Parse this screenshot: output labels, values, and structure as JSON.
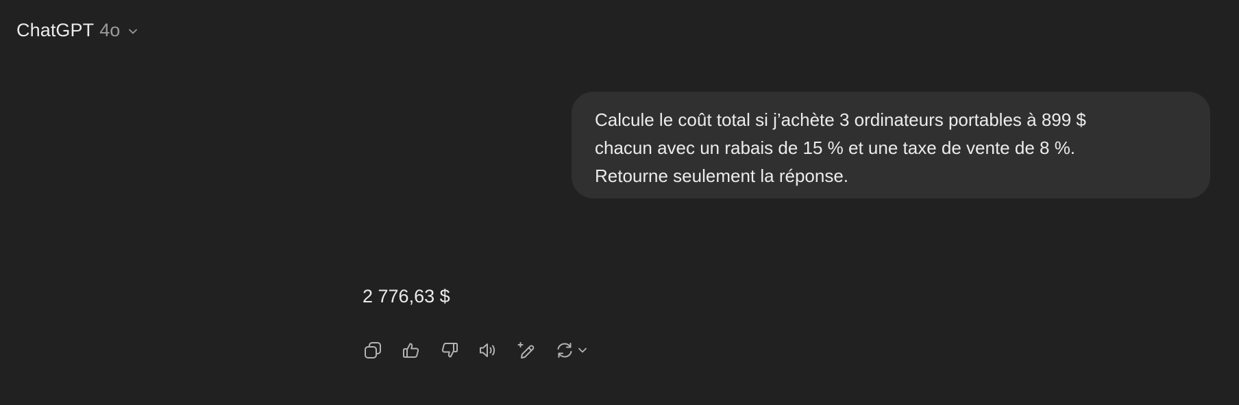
{
  "header": {
    "model_name": "ChatGPT",
    "model_version": "4o",
    "dropdown_icon": "chevron-down-icon"
  },
  "conversation": {
    "user_message": {
      "lines": [
        "Calcule le coût total si j’achète 3 ordinateurs portables à 899 $",
        "chacun avec un rabais de 15 % et une taxe de vente de 8 %.",
        "Retourne seulement la réponse."
      ]
    },
    "assistant_message": {
      "text": "2 776,63 $"
    }
  },
  "action_bar": {
    "icons": [
      "copy-icon",
      "thumbs-up-icon",
      "thumbs-down-icon",
      "read-aloud-icon",
      "edit-sparkle-icon",
      "regenerate-icon",
      "chevron-down-icon"
    ]
  },
  "colors": {
    "background": "#212121",
    "bubble": "#303030",
    "text": "#ececec",
    "muted": "#9b9b9b",
    "icon": "#b4b4b4"
  }
}
